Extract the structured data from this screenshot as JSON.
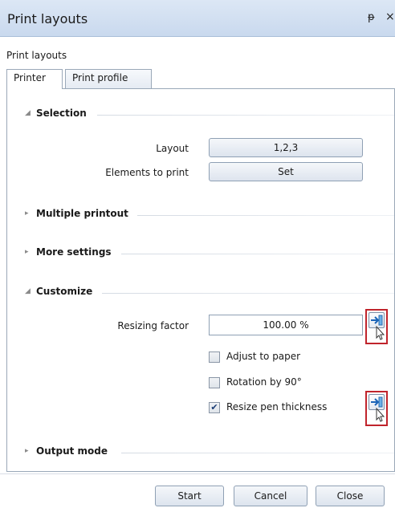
{
  "window": {
    "title": "Print layouts",
    "pin_glyph": "ᵽ",
    "close_glyph": "×"
  },
  "subtitle": "Print layouts",
  "tabs": [
    {
      "label": "Printer",
      "active": true
    },
    {
      "label": "Print profile",
      "active": false
    }
  ],
  "sections": {
    "selection": {
      "label": "Selection",
      "expanded": true,
      "layout_label": "Layout",
      "layout_value": "1,2,3",
      "elements_label": "Elements to print",
      "elements_button": "Set"
    },
    "multiple_printout": {
      "label": "Multiple printout",
      "expanded": false
    },
    "more_settings": {
      "label": "More settings",
      "expanded": false
    },
    "customize": {
      "label": "Customize",
      "expanded": true,
      "resizing_label": "Resizing factor",
      "resizing_value": "100.00 %",
      "adjust_to_paper": {
        "label": "Adjust to paper",
        "checked": false
      },
      "rotation": {
        "label": "Rotation by 90°",
        "checked": false
      },
      "resize_pen": {
        "label": "Resize pen thickness",
        "checked": true
      }
    },
    "output_mode": {
      "label": "Output mode",
      "expanded": false
    }
  },
  "icons": {
    "expanded_arrow": "◢",
    "collapsed_arrow": "▸",
    "check_mark": "✔",
    "apply_icon": "arrow-to-field-icon"
  },
  "footer": {
    "start": "Start",
    "cancel": "Cancel",
    "close": "Close"
  },
  "colors": {
    "highlight_border": "#c0242c",
    "title_bar": "#d4e1f2"
  }
}
